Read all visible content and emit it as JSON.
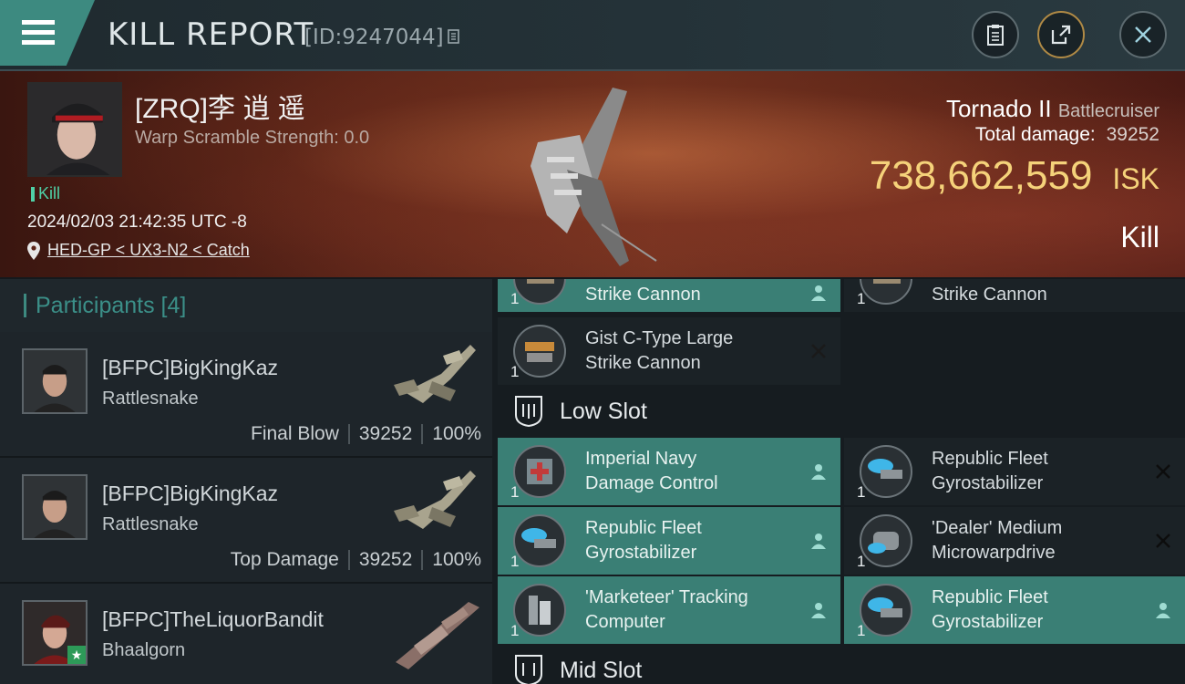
{
  "header": {
    "title": "KILL REPORT",
    "report_id": "[ID:9247044]"
  },
  "victim": {
    "name": "[ZRQ]李 逍 遥",
    "scramble": "Warp Scramble Strength: 0.0",
    "kill_tag": "Kill",
    "datetime": "2024/02/03 21:42:35 UTC -8",
    "location": "HED-GP < UX3-N2 < Catch",
    "ship": "Tornado II",
    "ship_class": "Battlecruiser",
    "total_damage_label": "Total damage:",
    "total_damage": "39252",
    "isk_value": "738,662,559",
    "isk_unit": "ISK",
    "result": "Kill"
  },
  "participants": {
    "title": "Participants [4]",
    "rows": [
      {
        "name": "[BFPC]BigKingKaz",
        "ship": "Rattlesnake",
        "role": "Final Blow",
        "damage": "39252",
        "percent": "100%"
      },
      {
        "name": "[BFPC]BigKingKaz",
        "ship": "Rattlesnake",
        "role": "Top Damage",
        "damage": "39252",
        "percent": "100%"
      },
      {
        "name": "[BFPC]TheLiquorBandit",
        "ship": "Bhaalgorn"
      }
    ]
  },
  "modules": {
    "top_left_partial": {
      "qty": "1",
      "name": "Strike Cannon"
    },
    "top_right_partial": {
      "qty": "1",
      "name": "Strike Cannon"
    },
    "gist": {
      "qty": "1",
      "name_line1": "Gist C-Type Large",
      "name_line2": "Strike Cannon"
    },
    "low_slot_title": "Low Slot",
    "low": [
      {
        "qty": "1",
        "line1": "Imperial Navy",
        "line2": "Damage Control"
      },
      {
        "qty": "1",
        "line1": "Republic Fleet",
        "line2": "Gyrostabilizer"
      },
      {
        "qty": "1",
        "line1": "Republic Fleet",
        "line2": "Gyrostabilizer"
      },
      {
        "qty": "1",
        "line1": "'Dealer' Medium",
        "line2": "Microwarpdrive"
      },
      {
        "qty": "1",
        "line1": "'Marketeer' Tracking",
        "line2": "Computer"
      },
      {
        "qty": "1",
        "line1": "Republic Fleet",
        "line2": "Gyrostabilizer"
      }
    ],
    "mid_slot_title": "Mid Slot"
  },
  "colors": {
    "accent_teal": "#3d8a80",
    "isk_gold": "#f5d27a",
    "kill_green": "#4fd0a6"
  }
}
